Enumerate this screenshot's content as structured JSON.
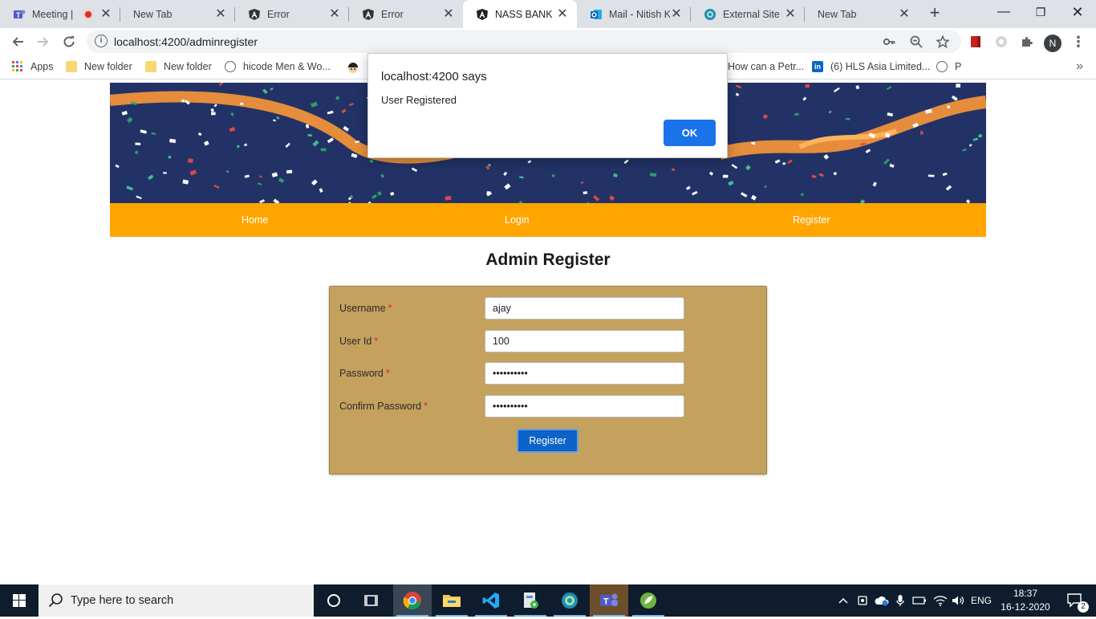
{
  "browser": {
    "tabs": [
      {
        "title": "Meeting |",
        "icon": "teams-icon"
      },
      {
        "title": "New Tab",
        "icon": ""
      },
      {
        "title": "Error",
        "icon": "angular-icon"
      },
      {
        "title": "Error",
        "icon": "angular-icon"
      },
      {
        "title": "NASS BANK",
        "icon": "angular-icon",
        "active": true
      },
      {
        "title": "Mail - Nitish K",
        "icon": "outlook-icon"
      },
      {
        "title": "External Site",
        "icon": "globe-icon"
      },
      {
        "title": "New Tab",
        "icon": ""
      }
    ],
    "url": "localhost:4200/adminregister",
    "profile_initial": "N",
    "bookmarks": [
      {
        "label": "Apps"
      },
      {
        "label": "New folder"
      },
      {
        "label": "New folder"
      },
      {
        "label": "hicode Men & Wo..."
      },
      {
        "label": "How can a Petr..."
      },
      {
        "label": "(6) HLS Asia Limited..."
      },
      {
        "label": "P"
      }
    ]
  },
  "page": {
    "nav": {
      "home": "Home",
      "login": "Login",
      "register": "Register"
    },
    "title": "Admin Register",
    "form": {
      "username_label": "Username",
      "username_value": "ajay",
      "userid_label": "User Id",
      "userid_value": "100",
      "password_label": "Password",
      "password_value": "••••••••••",
      "confirm_label": "Confirm Password",
      "confirm_value": "••••••••••",
      "required_mark": "*",
      "submit_label": "Register"
    }
  },
  "dialog": {
    "title": "localhost:4200 says",
    "message": "User Registered",
    "ok_label": "OK"
  },
  "taskbar": {
    "search_placeholder": "Type here to search",
    "language": "ENG",
    "time": "18:37",
    "date": "16-12-2020",
    "notification_count": "2"
  }
}
